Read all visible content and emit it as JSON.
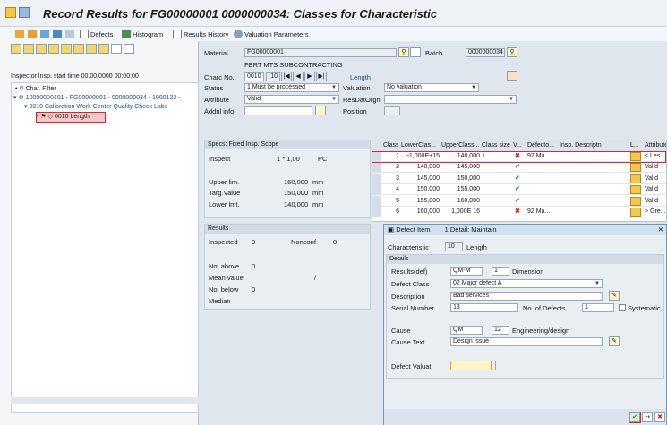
{
  "window": {
    "title": "Record Results for FG00000001 0000000034: Classes for Characteristic"
  },
  "toolbar": {
    "defects": "Defects",
    "histogram": "Histogram",
    "results_history": "Results History",
    "valuation_parameters": "Valuation Parameters"
  },
  "tree": {
    "header": "Inspector Insp. start time 00.00.0000 00:00:00",
    "items": [
      "Char. Filter",
      "10000000101 - FG00000001 - 0000000034 - 1000122 -",
      "0010 Calibration Work Center Quality Check Labs",
      "0010 Length"
    ]
  },
  "header": {
    "material_label": "Material",
    "material_value": "FG00000001",
    "material_desc": "FERT MTS SUBCONTRACTING",
    "batch_label": "Batch",
    "batch_value": "0000000034",
    "charc_label": "Charc No.",
    "charc_value": "0010",
    "charc_seq": "10",
    "charc_name": "Length",
    "status_label": "Status",
    "status_value": "1 Must be processed",
    "valuation_label": "Valuation",
    "valuation_value": "No valuation",
    "attribute_label": "Attribute",
    "attribute_value": "Valid",
    "resdatorgn_label": "ResDatOrgn",
    "resdatorgn_value": "",
    "addnl_label": "Addnl info",
    "position_label": "Position"
  },
  "specs": {
    "title": "Specs: Fixed Insp. Scope",
    "inspect_label": "Inspect",
    "inspect_value": "1 * 1,00",
    "inspect_unit": "PC",
    "upper_label": "Upper lim.",
    "upper_value": "160,000",
    "upper_unit": "mm",
    "targ_label": "Targ.Value",
    "targ_value": "150,000",
    "targ_unit": "mm",
    "lower_label": "Lower lmt.",
    "lower_value": "140,000",
    "lower_unit": "mm"
  },
  "results": {
    "title": "Results",
    "inspected_label": "Inspected",
    "inspected_value": "0",
    "nonconf_label": "Nonconf.",
    "nonconf_value": "0",
    "above_label": "No. above",
    "above_value": "0",
    "mean_label": "Mean value",
    "mean_value": "/",
    "below_label": "No. below",
    "below_value": "0",
    "median_label": "Median"
  },
  "grid": {
    "headers": [
      "Class",
      "LowerClas...",
      "UpperClass...",
      "Class size",
      "V...",
      "Defecto...",
      "Insp. Descriptn",
      "L...",
      "Attribute"
    ],
    "rows": [
      {
        "cls": "1",
        "lower": "-1,000E+15",
        "upper": "140,000",
        "size": "1",
        "v": "x",
        "def": "92 Ma...",
        "attr": "< Les..."
      },
      {
        "cls": "2",
        "lower": "140,000",
        "upper": "145,000",
        "size": "",
        "v": "ok",
        "def": "",
        "attr": "Valid"
      },
      {
        "cls": "3",
        "lower": "145,000",
        "upper": "150,000",
        "size": "",
        "v": "ok",
        "def": "",
        "attr": "Valid"
      },
      {
        "cls": "4",
        "lower": "150,000",
        "upper": "155,000",
        "size": "",
        "v": "ok",
        "def": "",
        "attr": "Valid"
      },
      {
        "cls": "5",
        "lower": "155,000",
        "upper": "160,000",
        "size": "",
        "v": "ok",
        "def": "",
        "attr": "Valid"
      },
      {
        "cls": "6",
        "lower": "160,000",
        "upper": "1,000E 16",
        "size": "",
        "v": "x",
        "def": "92 Ma...",
        "attr": "> Gre..."
      }
    ]
  },
  "dialog": {
    "title": "Defect Item",
    "subtitle": "1 Detail: Maintain",
    "char_label": "Characteristic",
    "char_value": "10",
    "char_name": "Length",
    "details_label": "Details",
    "results_def_label": "Results(def)",
    "results_def_code": "QM-M",
    "results_def_num": "1",
    "results_def_text": "Dimension",
    "defect_class_label": "Defect Class",
    "defect_class_value": "02 Major defect A",
    "description_label": "Description",
    "description_value": "Bad services",
    "serial_label": "Serial Number",
    "serial_value": "13",
    "num_defects_label": "No. of Defects",
    "num_defects_value": "1",
    "systematic_label": "Systematic",
    "cause_label": "Cause",
    "cause_code": "QM",
    "cause_num": "12",
    "cause_text": "Engineering/design",
    "cause_text_label": "Cause Text",
    "cause_text_value": "Design issue",
    "defect_valuat_label": "Defect Valuat."
  }
}
